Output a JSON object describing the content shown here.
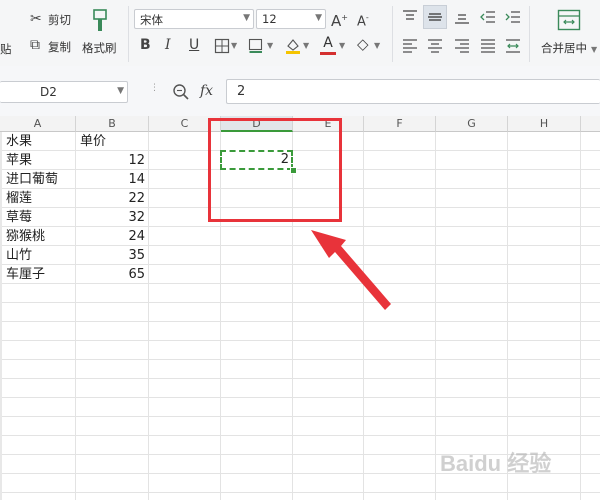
{
  "ribbon": {
    "paste_label": "贴",
    "cut_label": "剪切",
    "copy_label": "复制",
    "format_painter_label": "格式刷",
    "font_name": "宋体",
    "font_size": "12",
    "merge_label": "合并居中"
  },
  "formula_bar": {
    "name_box": "D2",
    "fx_label": "fx",
    "value": "2"
  },
  "sheet": {
    "columns": [
      "A",
      "B",
      "C",
      "D",
      "E",
      "F",
      "G",
      "H"
    ],
    "header": {
      "fruit": "水果",
      "price": "单价"
    },
    "rows": [
      {
        "name": "苹果",
        "price": "12"
      },
      {
        "name": "进口葡萄",
        "price": "14"
      },
      {
        "name": "榴莲",
        "price": "22"
      },
      {
        "name": "草莓",
        "price": "32"
      },
      {
        "name": "猕猴桃",
        "price": "24"
      },
      {
        "name": "山竹",
        "price": "35"
      },
      {
        "name": "车厘子",
        "price": "65"
      }
    ],
    "d2_value": "2"
  },
  "colors": {
    "selection": "#3a9a3a",
    "annotation": "#e8333a"
  },
  "watermark": "Baidu 经验"
}
